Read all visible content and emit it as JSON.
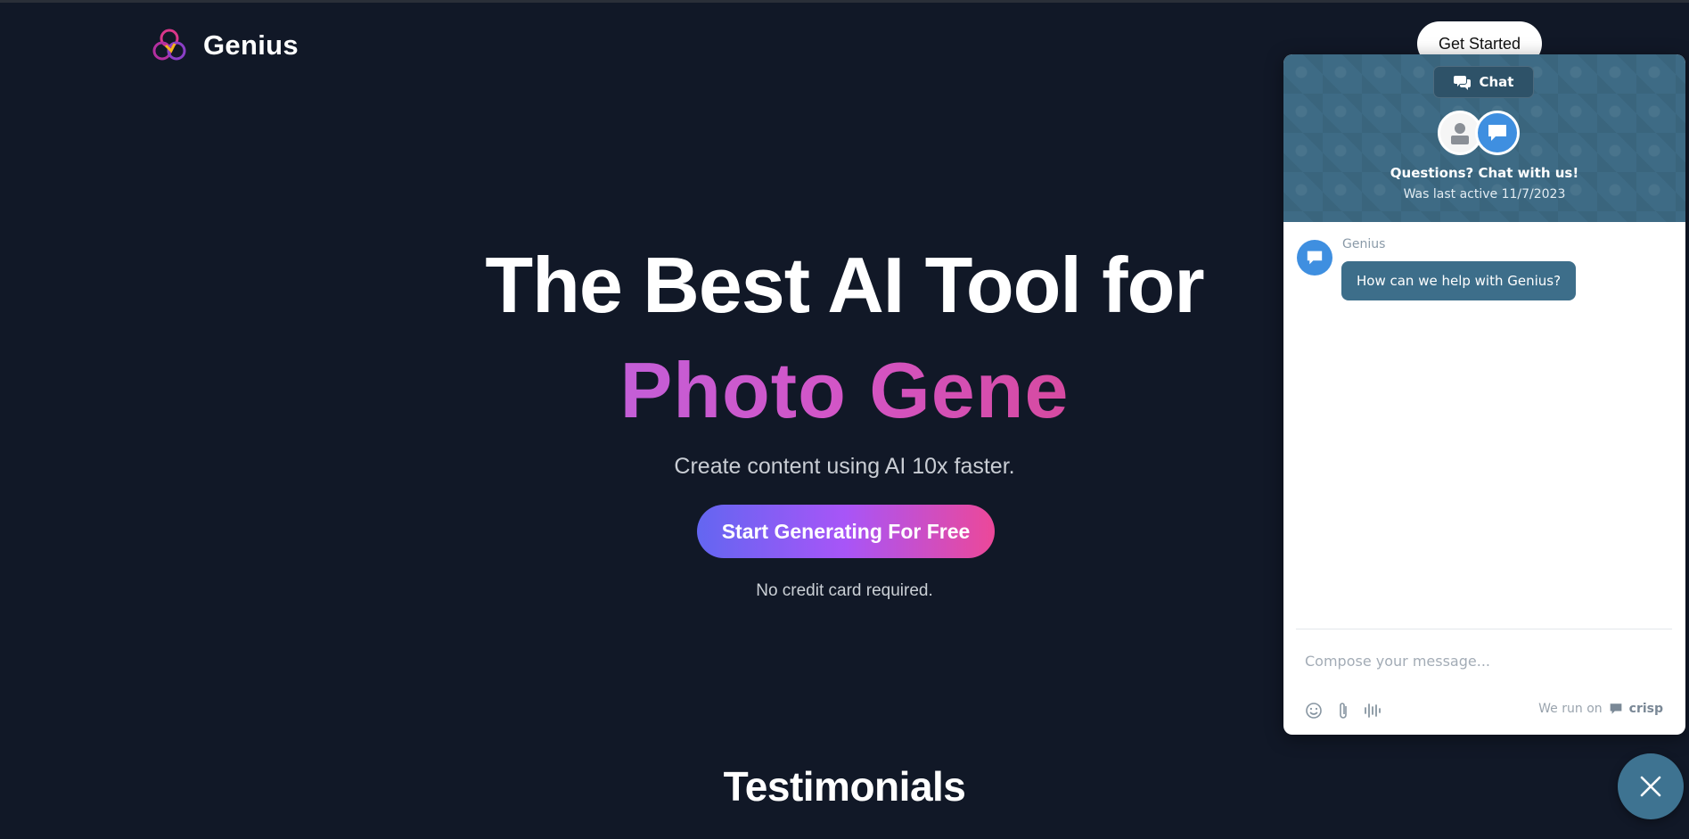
{
  "header": {
    "brand": "Genius",
    "get_started_label": "Get Started"
  },
  "hero": {
    "title_line1": "The Best AI Tool for",
    "title_line2": "Photo Gene",
    "subtitle": "Create content using AI 10x faster.",
    "cta_label": "Start Generating For Free",
    "note": "No credit card required."
  },
  "sections": {
    "testimonials_title": "Testimonials"
  },
  "chat": {
    "tab_label": "Chat",
    "title": "Questions? Chat with us!",
    "last_active": "Was last active 11/7/2023",
    "messages": [
      {
        "sender": "Genius",
        "text": "How can we help with Genius?"
      }
    ],
    "compose_placeholder": "Compose your message...",
    "powered_prefix": "We run on",
    "powered_brand": "crisp",
    "accent_color": "#3e7391"
  },
  "colors": {
    "background": "#111827",
    "cta_gradient_start": "#6366f1",
    "cta_gradient_end": "#ec4899",
    "accent_text": "#c35ed7"
  }
}
